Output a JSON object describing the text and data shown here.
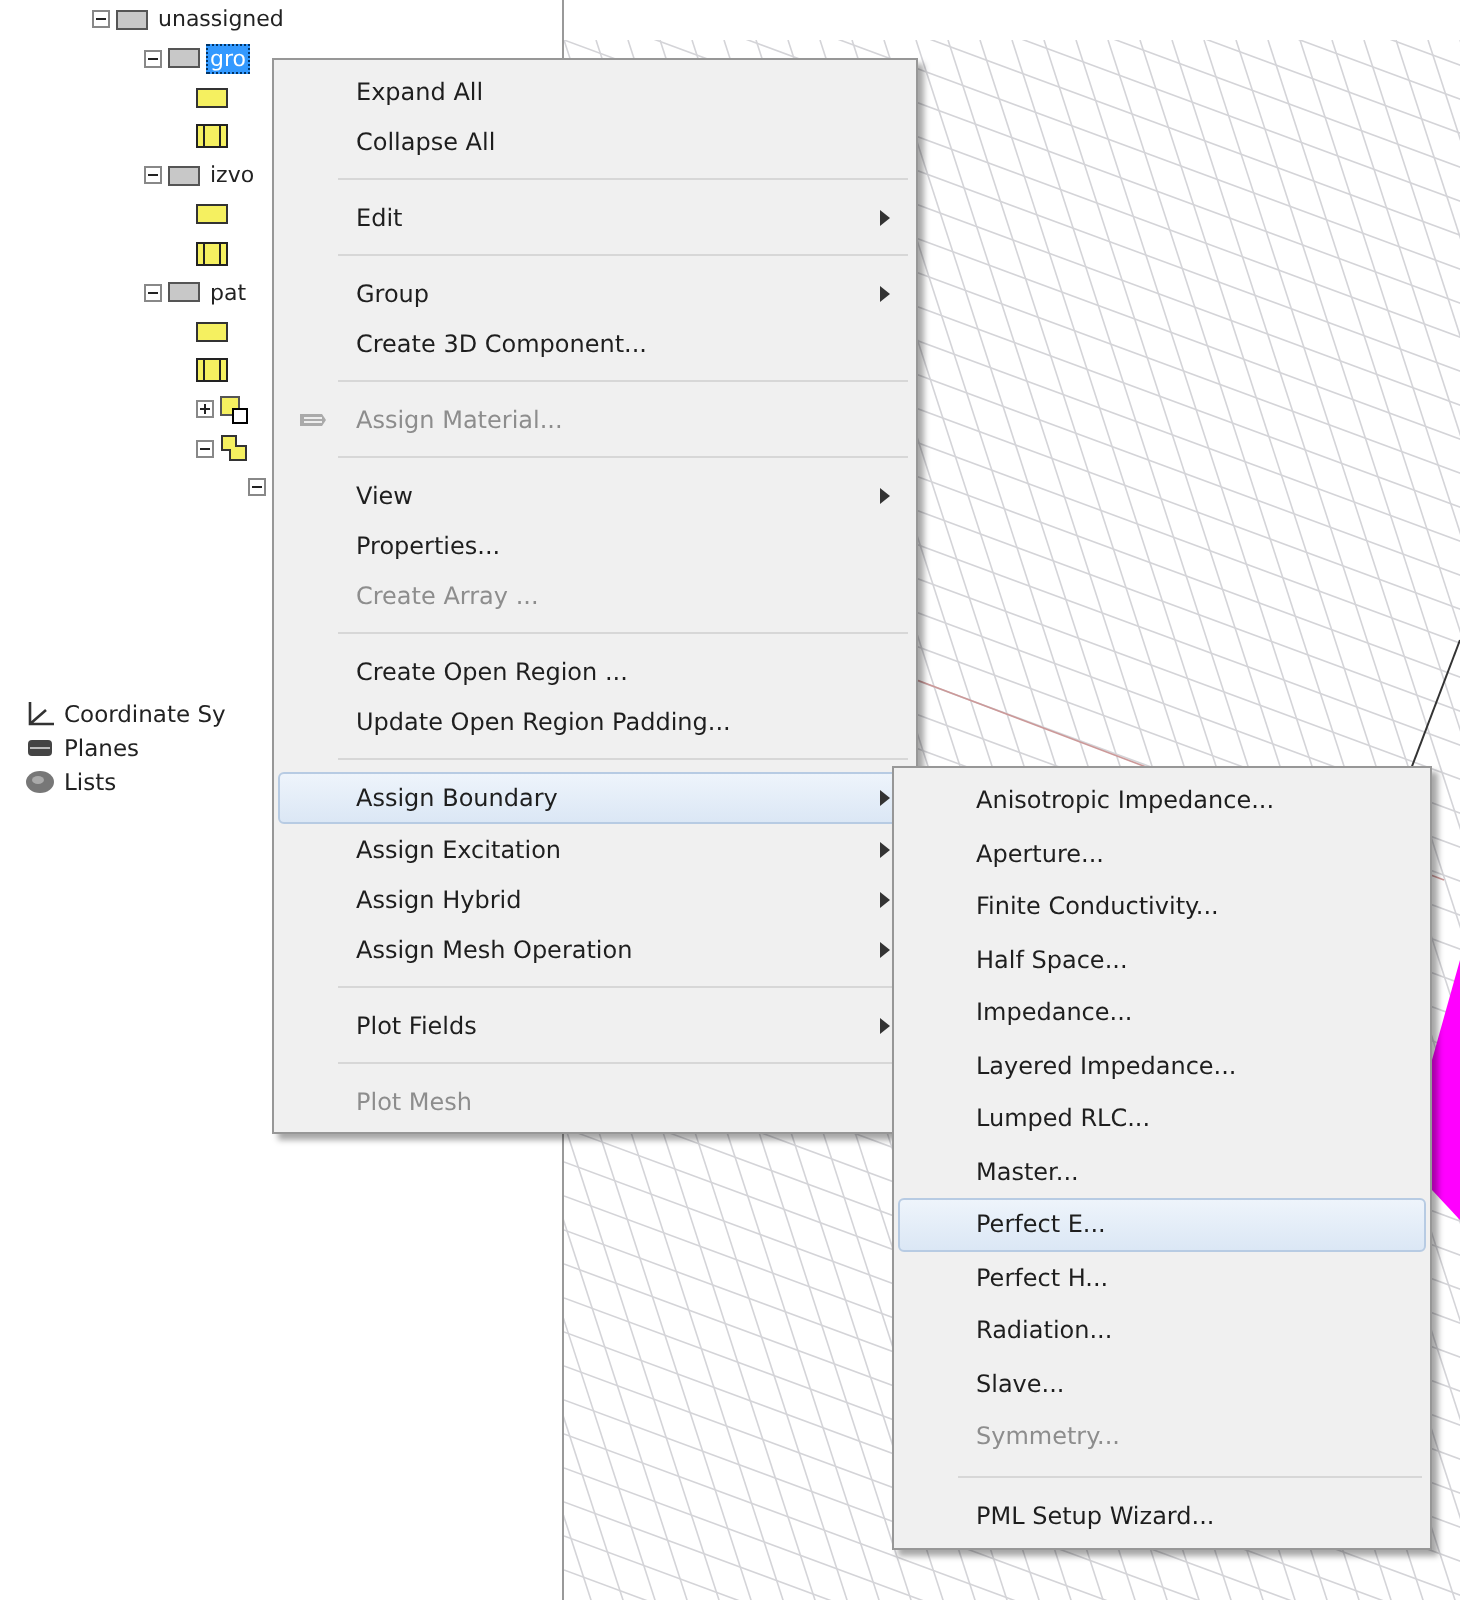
{
  "tree": {
    "items": [
      {
        "label": "unassigned",
        "kind": "group",
        "expanded": true,
        "selected": false,
        "children": [
          {
            "label": "gro",
            "kind": "group",
            "expanded": true,
            "selected": true,
            "children": [
              {
                "kind": "sheet"
              },
              {
                "kind": "solid"
              }
            ]
          },
          {
            "label": "izvo",
            "kind": "group",
            "expanded": true,
            "selected": false,
            "children": [
              {
                "kind": "sheet"
              },
              {
                "kind": "solid"
              }
            ]
          },
          {
            "label": "pat",
            "kind": "group",
            "expanded": true,
            "selected": false,
            "children": [
              {
                "kind": "sheet"
              },
              {
                "kind": "solid"
              },
              {
                "kind": "union",
                "expanded": false
              },
              {
                "kind": "step",
                "expanded": true,
                "children": [
                  {
                    "expanded": true
                  }
                ]
              }
            ]
          }
        ]
      }
    ],
    "footer": [
      {
        "label": "Coordinate Sy",
        "kind": "axes"
      },
      {
        "label": "Planes",
        "kind": "planes"
      },
      {
        "label": "Lists",
        "kind": "lists"
      }
    ]
  },
  "context_menu": {
    "groups": [
      [
        {
          "label": "Expand All",
          "disabled": false,
          "submenu": false,
          "selected": false
        },
        {
          "label": "Collapse All",
          "disabled": false,
          "submenu": false,
          "selected": false
        }
      ],
      [
        {
          "label": "Edit",
          "disabled": false,
          "submenu": true,
          "selected": false
        }
      ],
      [
        {
          "label": "Group",
          "disabled": false,
          "submenu": true,
          "selected": false
        },
        {
          "label": "Create 3D Component...",
          "disabled": false,
          "submenu": false,
          "selected": false
        }
      ],
      [
        {
          "label": "Assign Material...",
          "disabled": true,
          "submenu": false,
          "selected": false,
          "kind": "icon"
        }
      ],
      [
        {
          "label": "View",
          "disabled": false,
          "submenu": true,
          "selected": false
        },
        {
          "label": "Properties...",
          "disabled": false,
          "submenu": false,
          "selected": false
        },
        {
          "label": "Create Array ...",
          "disabled": true,
          "submenu": false,
          "selected": false
        }
      ],
      [
        {
          "label": "Create Open Region ...",
          "disabled": false,
          "submenu": false,
          "selected": false
        },
        {
          "label": "Update Open Region Padding...",
          "disabled": false,
          "submenu": false,
          "selected": false
        }
      ],
      [
        {
          "label": "Assign Boundary",
          "disabled": false,
          "submenu": true,
          "selected": true
        },
        {
          "label": "Assign Excitation",
          "disabled": false,
          "submenu": true,
          "selected": false
        },
        {
          "label": "Assign Hybrid",
          "disabled": false,
          "submenu": true,
          "selected": false
        },
        {
          "label": "Assign Mesh Operation",
          "disabled": false,
          "submenu": true,
          "selected": false
        }
      ],
      [
        {
          "label": "Plot Fields",
          "disabled": false,
          "submenu": true,
          "selected": false
        }
      ],
      [
        {
          "label": "Plot Mesh",
          "disabled": true,
          "submenu": false,
          "selected": false
        }
      ]
    ]
  },
  "submenu": {
    "groups": [
      [
        {
          "label": "Anisotropic Impedance...",
          "disabled": false,
          "selected": false
        },
        {
          "label": "Aperture...",
          "disabled": false,
          "selected": false
        },
        {
          "label": "Finite Conductivity...",
          "disabled": false,
          "selected": false
        },
        {
          "label": "Half Space...",
          "disabled": false,
          "selected": false
        },
        {
          "label": "Impedance...",
          "disabled": false,
          "selected": false
        },
        {
          "label": "Layered Impedance...",
          "disabled": false,
          "selected": false
        },
        {
          "label": "Lumped RLC...",
          "disabled": false,
          "selected": false
        },
        {
          "label": "Master...",
          "disabled": false,
          "selected": false
        },
        {
          "label": "Perfect E...",
          "disabled": false,
          "selected": true
        },
        {
          "label": "Perfect H...",
          "disabled": false,
          "selected": false
        },
        {
          "label": "Radiation...",
          "disabled": false,
          "selected": false
        },
        {
          "label": "Slave...",
          "disabled": false,
          "selected": false
        },
        {
          "label": "Symmetry...",
          "disabled": true,
          "selected": false
        }
      ],
      [
        {
          "label": "PML Setup Wizard...",
          "disabled": false,
          "selected": false
        }
      ]
    ]
  }
}
